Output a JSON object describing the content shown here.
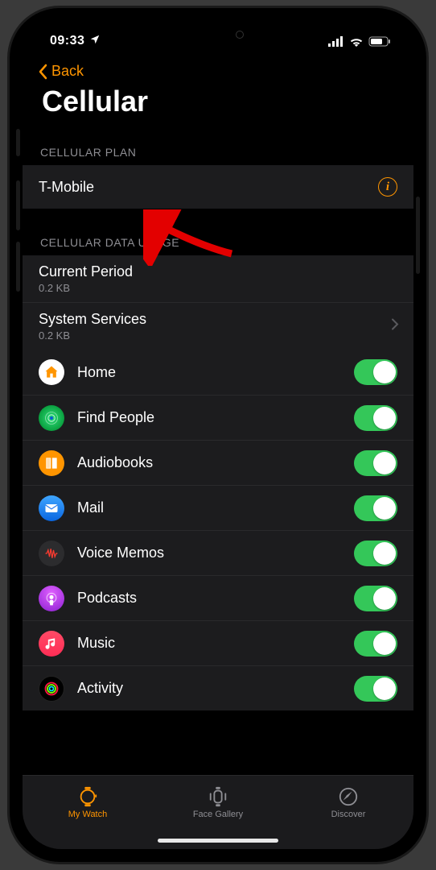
{
  "status": {
    "time": "09:33"
  },
  "nav": {
    "back": "Back",
    "title": "Cellular"
  },
  "sections": {
    "plan_header": "CELLULAR PLAN",
    "plan_name": "T-Mobile",
    "usage_header": "CELLULAR DATA USAGE",
    "current_period_label": "Current Period",
    "current_period_value": "0.2 KB",
    "system_services_label": "System Services",
    "system_services_value": "0.2 KB"
  },
  "apps": [
    {
      "name": "Home",
      "icon": "home"
    },
    {
      "name": "Find People",
      "icon": "find"
    },
    {
      "name": "Audiobooks",
      "icon": "audio"
    },
    {
      "name": "Mail",
      "icon": "mail"
    },
    {
      "name": "Voice Memos",
      "icon": "voice"
    },
    {
      "name": "Podcasts",
      "icon": "pod"
    },
    {
      "name": "Music",
      "icon": "music"
    },
    {
      "name": "Activity",
      "icon": "act"
    }
  ],
  "tabs": {
    "watch": "My Watch",
    "gallery": "Face Gallery",
    "discover": "Discover"
  }
}
